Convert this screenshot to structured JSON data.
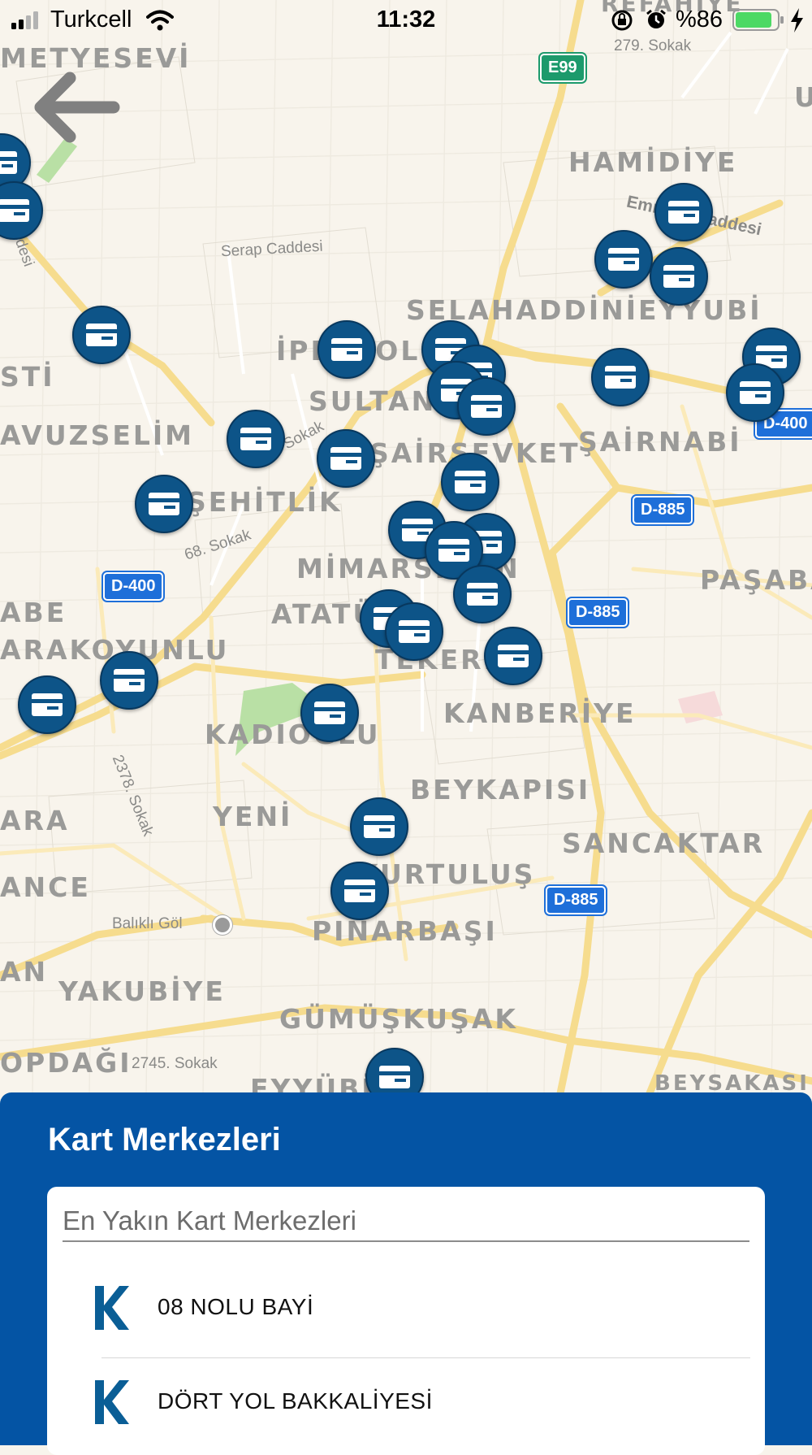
{
  "status_bar": {
    "carrier": "Turkcell",
    "time": "11:32",
    "battery_percent": "%86"
  },
  "map": {
    "area_labels": [
      "METYESEVİ",
      "HAMİDİYE",
      "SELAHADDİNİEYYUBİ",
      "İPEKYOL",
      "SULTANBAŞI",
      "AVUZSELİM",
      "ŞAİRNABİ",
      "ŞAİRŞEVKET",
      "ŞEHİTLİK",
      "MİMARSİNAN",
      "PAŞABAĞ",
      "ABE",
      "ATATÜRK",
      "ARAKOYUNLU",
      "TEKEREK",
      "KANBERİYE",
      "KADIOĞLU",
      "BEYKAPISI",
      "YENİ",
      "SANCAKTAR",
      "ARA",
      "KURTULUŞ",
      "ANCE",
      "PINARBAŞI",
      "AN",
      "YAKUBİYE",
      "GÜMÜŞKUŞAK",
      "OPDAĞI",
      "EYYÜBİYE",
      "BEYSAKASI",
      "STİ",
      "REFAHİYE",
      "U"
    ],
    "street_labels": [
      "279. Sokak",
      "Serap Caddesi",
      "Emniyet Caddesi",
      "desi",
      "2. Sokak",
      "68. Sokak",
      "2378. Sokak",
      "Balıklı Göl",
      "2745. Sokak"
    ],
    "road_shields": [
      "E99",
      "D-400",
      "D-400",
      "D-885",
      "D-885",
      "D-885"
    ],
    "marker_icon": "card-center-icon",
    "marker_count": 36
  },
  "panel": {
    "title": "Kart Merkezleri",
    "search_placeholder": "En Yakın Kart Merkezleri",
    "items": [
      {
        "name": "08 NOLU BAYİ",
        "logo": "K"
      },
      {
        "name": "DÖRT YOL BAKKALİYESİ",
        "logo": "K"
      }
    ]
  },
  "colors": {
    "panel_bg": "#0454a4",
    "marker": "#0d5488",
    "logo": "#0a5e96",
    "road_shield_blue": "#1e6fd9",
    "road_shield_green": "#1c9a6c"
  }
}
